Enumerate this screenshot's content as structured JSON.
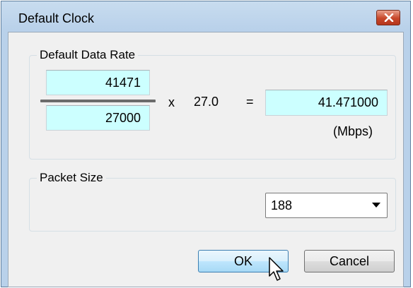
{
  "window": {
    "title": "Default Clock"
  },
  "data_rate": {
    "group_label": "Default Data Rate",
    "numerator": "41471",
    "denominator": "27000",
    "multiply_sign": "x",
    "multiplier": "27.0",
    "equals_sign": "=",
    "result": "41.471000",
    "unit": "(Mbps)"
  },
  "packet": {
    "group_label": "Packet Size",
    "selected": "188"
  },
  "buttons": {
    "ok": "OK",
    "cancel": "Cancel"
  },
  "icons": {
    "close": "close-icon",
    "dropdown": "chevron-down-icon",
    "cursor": "mouse-pointer-icon"
  },
  "colors": {
    "field_bg": "#ccffff",
    "close_btn": "#c7472a",
    "ok_btn": "#bee6fd"
  }
}
